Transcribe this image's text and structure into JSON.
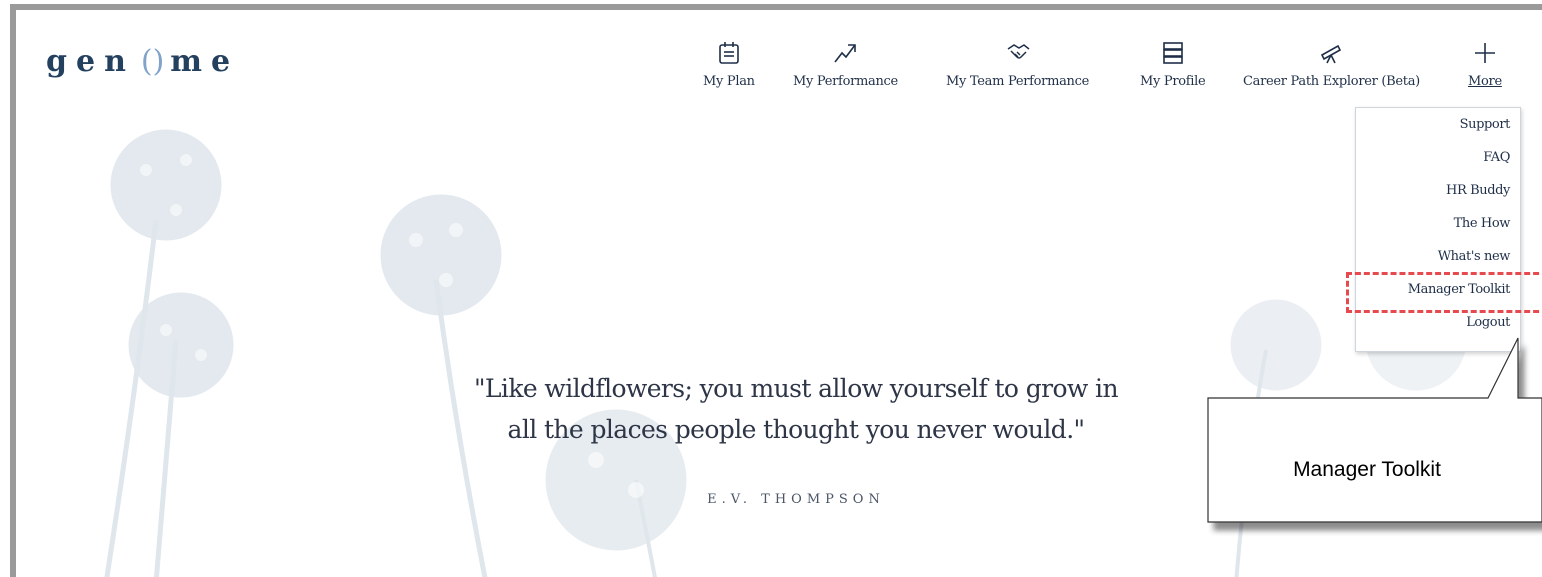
{
  "brand": {
    "logo_text_left": "gen",
    "logo_mark": "()",
    "logo_text_right": "me"
  },
  "nav": {
    "items": [
      {
        "label": "My Plan",
        "icon": "calendar-icon"
      },
      {
        "label": "My Performance",
        "icon": "trend-up-icon"
      },
      {
        "label": "My Team Performance",
        "icon": "handshake-icon"
      },
      {
        "label": "My Profile",
        "icon": "server-stack-icon"
      },
      {
        "label": "Career Path Explorer (Beta)",
        "icon": "telescope-icon"
      },
      {
        "label": "More",
        "icon": "plus-icon"
      }
    ]
  },
  "more_menu": {
    "items": [
      "Support",
      "FAQ",
      "HR Buddy",
      "The How",
      "What's new",
      "Manager Toolkit",
      "Logout"
    ],
    "highlighted": "Manager Toolkit"
  },
  "quote": {
    "line1": "\"Like wildflowers; you must allow yourself to grow in",
    "line2": "all the places people thought you never would.\"",
    "author": "E.V. THOMPSON"
  },
  "callout": {
    "text": "Manager Toolkit"
  },
  "colors": {
    "highlight": "#e64a4f",
    "brand": "#24405f",
    "text": "#1f2f48"
  }
}
